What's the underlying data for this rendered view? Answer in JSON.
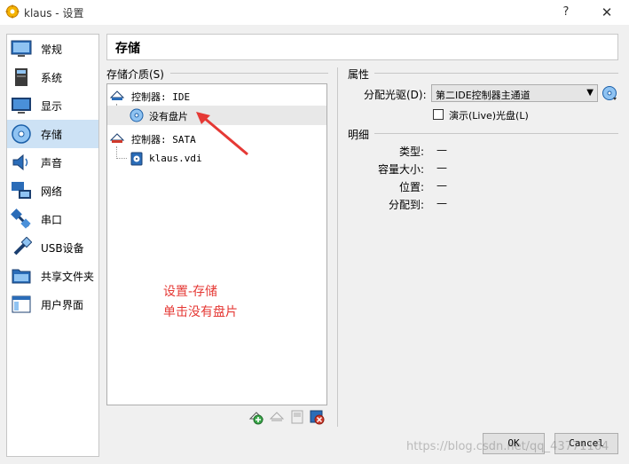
{
  "window": {
    "title": "klaus - 设置",
    "help_glyph": "?",
    "close_glyph": "✕"
  },
  "sidebar": {
    "items": [
      {
        "label": "常规",
        "icon": "general-icon"
      },
      {
        "label": "系统",
        "icon": "system-icon"
      },
      {
        "label": "显示",
        "icon": "display-icon"
      },
      {
        "label": "存储",
        "icon": "storage-icon",
        "active": true
      },
      {
        "label": "声音",
        "icon": "audio-icon"
      },
      {
        "label": "网络",
        "icon": "network-icon"
      },
      {
        "label": "串口",
        "icon": "serial-port-icon"
      },
      {
        "label": "USB设备",
        "icon": "usb-icon"
      },
      {
        "label": "共享文件夹",
        "icon": "shared-folder-icon"
      },
      {
        "label": "用户界面",
        "icon": "user-interface-icon"
      }
    ]
  },
  "header": {
    "title": "存储"
  },
  "storage": {
    "group_label": "存储介质(S)",
    "tree": {
      "controller_ide": "控制器: IDE",
      "no_disk": "没有盘片",
      "controller_sata": "控制器: SATA",
      "vdi": "klaus.vdi"
    }
  },
  "attributes": {
    "group_label": "属性",
    "optical_drive_label": "分配光驱(D):",
    "optical_drive_value": "第二IDE控制器主通道",
    "live_cd_label": "演示(Live)光盘(L)"
  },
  "details": {
    "group_label": "明细",
    "rows": [
      {
        "key": "类型:",
        "value": "—"
      },
      {
        "key": "容量大小:",
        "value": "—"
      },
      {
        "key": "位置:",
        "value": "—"
      },
      {
        "key": "分配到:",
        "value": "—"
      }
    ]
  },
  "annotation": {
    "line1": "设置-存储",
    "line2": "单击没有盘片",
    "color": "#e53935"
  },
  "buttons": {
    "ok": "OK",
    "cancel": "Cancel"
  },
  "watermark": "https://blog.csdn.net/qq_43771164"
}
